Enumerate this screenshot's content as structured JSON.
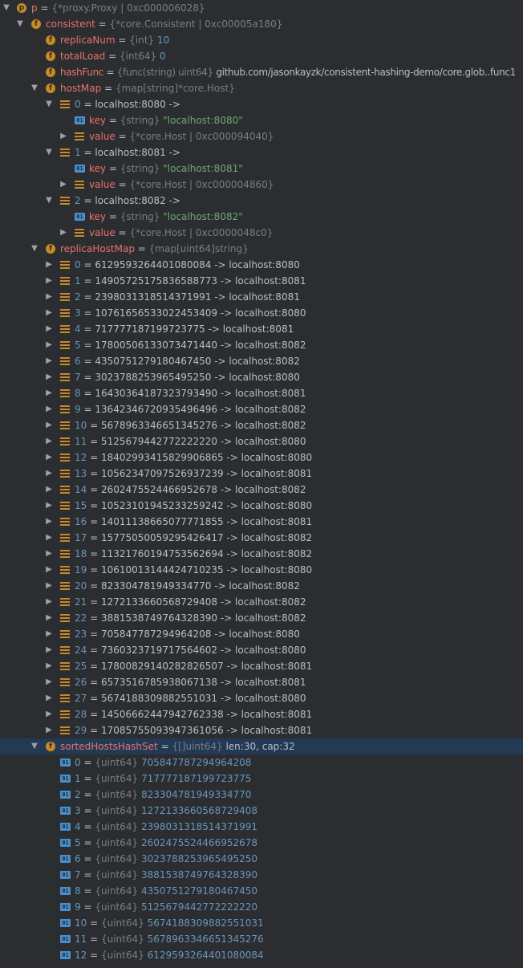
{
  "p": {
    "name": "p",
    "type": "{*proxy.Proxy | 0xc000006028}"
  },
  "consistent": {
    "name": "consistent",
    "type": "{*core.Consistent | 0xc00005a180}"
  },
  "replicaNum": {
    "name": "replicaNum",
    "type": "{int}",
    "value": "10"
  },
  "totalLoad": {
    "name": "totalLoad",
    "type": "{int64}",
    "value": "0"
  },
  "hashFunc": {
    "name": "hashFunc",
    "type": "{func(string) uint64}",
    "value": "github.com/jasonkayzk/consistent-hashing-demo/core.glob..func1"
  },
  "hostMap": {
    "name": "hostMap",
    "type": "{map[string]*core.Host}",
    "entries": [
      {
        "index": "0",
        "label": "localhost:8080 ->",
        "key_name": "key",
        "key_type": "{string}",
        "key_value": "\"localhost:8080\"",
        "value_name": "value",
        "value_type": "{*core.Host | 0xc000094040}"
      },
      {
        "index": "1",
        "label": "localhost:8081 ->",
        "key_name": "key",
        "key_type": "{string}",
        "key_value": "\"localhost:8081\"",
        "value_name": "value",
        "value_type": "{*core.Host | 0xc000004860}"
      },
      {
        "index": "2",
        "label": "localhost:8082 ->",
        "key_name": "key",
        "key_type": "{string}",
        "key_value": "\"localhost:8082\"",
        "value_name": "value",
        "value_type": "{*core.Host | 0xc0000048c0}"
      }
    ]
  },
  "replicaHostMap": {
    "name": "replicaHostMap",
    "type": "{map[uint64]string}",
    "entries": [
      {
        "index": "0",
        "text": "6129593264401080084 -> localhost:8080"
      },
      {
        "index": "1",
        "text": "14905725175836588773 -> localhost:8081"
      },
      {
        "index": "2",
        "text": "2398031318514371991 -> localhost:8081"
      },
      {
        "index": "3",
        "text": "10761656533022453409 -> localhost:8080"
      },
      {
        "index": "4",
        "text": "717777187199723775 -> localhost:8081"
      },
      {
        "index": "5",
        "text": "17800506133073471440 -> localhost:8082"
      },
      {
        "index": "6",
        "text": "4350751279180467450 -> localhost:8082"
      },
      {
        "index": "7",
        "text": "3023788253965495250 -> localhost:8080"
      },
      {
        "index": "8",
        "text": "16430364187323793490 -> localhost:8081"
      },
      {
        "index": "9",
        "text": "13642346720935496496 -> localhost:8082"
      },
      {
        "index": "10",
        "text": "5678963346651345276 -> localhost:8082"
      },
      {
        "index": "11",
        "text": "5125679442772222220 -> localhost:8080"
      },
      {
        "index": "12",
        "text": "18402993415829906865 -> localhost:8080"
      },
      {
        "index": "13",
        "text": "10562347097526937239 -> localhost:8081"
      },
      {
        "index": "14",
        "text": "2602475524466952678 -> localhost:8082"
      },
      {
        "index": "15",
        "text": "10523101945233259242 -> localhost:8080"
      },
      {
        "index": "16",
        "text": "14011138665077771855 -> localhost:8081"
      },
      {
        "index": "17",
        "text": "15775050059295426417 -> localhost:8082"
      },
      {
        "index": "18",
        "text": "11321760194753562694 -> localhost:8082"
      },
      {
        "index": "19",
        "text": "10610013144424710235 -> localhost:8080"
      },
      {
        "index": "20",
        "text": "823304781949334770 -> localhost:8082"
      },
      {
        "index": "21",
        "text": "1272133660568729408 -> localhost:8082"
      },
      {
        "index": "22",
        "text": "3881538749764328390 -> localhost:8082"
      },
      {
        "index": "23",
        "text": "705847787294964208 -> localhost:8080"
      },
      {
        "index": "24",
        "text": "7360323719717564602 -> localhost:8080"
      },
      {
        "index": "25",
        "text": "17800829140282826507 -> localhost:8081"
      },
      {
        "index": "26",
        "text": "6573516785938067138 -> localhost:8081"
      },
      {
        "index": "27",
        "text": "5674188309882551031 -> localhost:8080"
      },
      {
        "index": "28",
        "text": "14506662447942762338 -> localhost:8081"
      },
      {
        "index": "29",
        "text": "17085755093947361056 -> localhost:8081"
      }
    ]
  },
  "sortedHostsHashSet": {
    "name": "sortedHostsHashSet",
    "type": "{[]uint64}",
    "meta": "len:30, cap:32",
    "elem_type": "{uint64}",
    "entries": [
      {
        "index": "0",
        "value": "705847787294964208"
      },
      {
        "index": "1",
        "value": "717777187199723775"
      },
      {
        "index": "2",
        "value": "823304781949334770"
      },
      {
        "index": "3",
        "value": "1272133660568729408"
      },
      {
        "index": "4",
        "value": "2398031318514371991"
      },
      {
        "index": "5",
        "value": "2602475524466952678"
      },
      {
        "index": "6",
        "value": "3023788253965495250"
      },
      {
        "index": "7",
        "value": "3881538749764328390"
      },
      {
        "index": "8",
        "value": "4350751279180467450"
      },
      {
        "index": "9",
        "value": "5125679442772222220"
      },
      {
        "index": "10",
        "value": "5674188309882551031"
      },
      {
        "index": "11",
        "value": "5678963346651345276"
      },
      {
        "index": "12",
        "value": "6129593264401080084"
      }
    ]
  },
  "colors": {
    "background": "#2b2d30",
    "selected_row": "#233a55",
    "field_name": "#e8736c",
    "index": "#6897bb",
    "type": "#7a7e85",
    "string": "#6aab73",
    "number": "#6897bb",
    "field_icon": "#c98a26",
    "primitive_icon": "#4a8fc9"
  },
  "icons": {
    "expanded": "chevron-down-icon",
    "collapsed": "chevron-right-icon",
    "field": "field-icon",
    "entry": "list-icon",
    "primitive": "primitive-01-icon"
  }
}
